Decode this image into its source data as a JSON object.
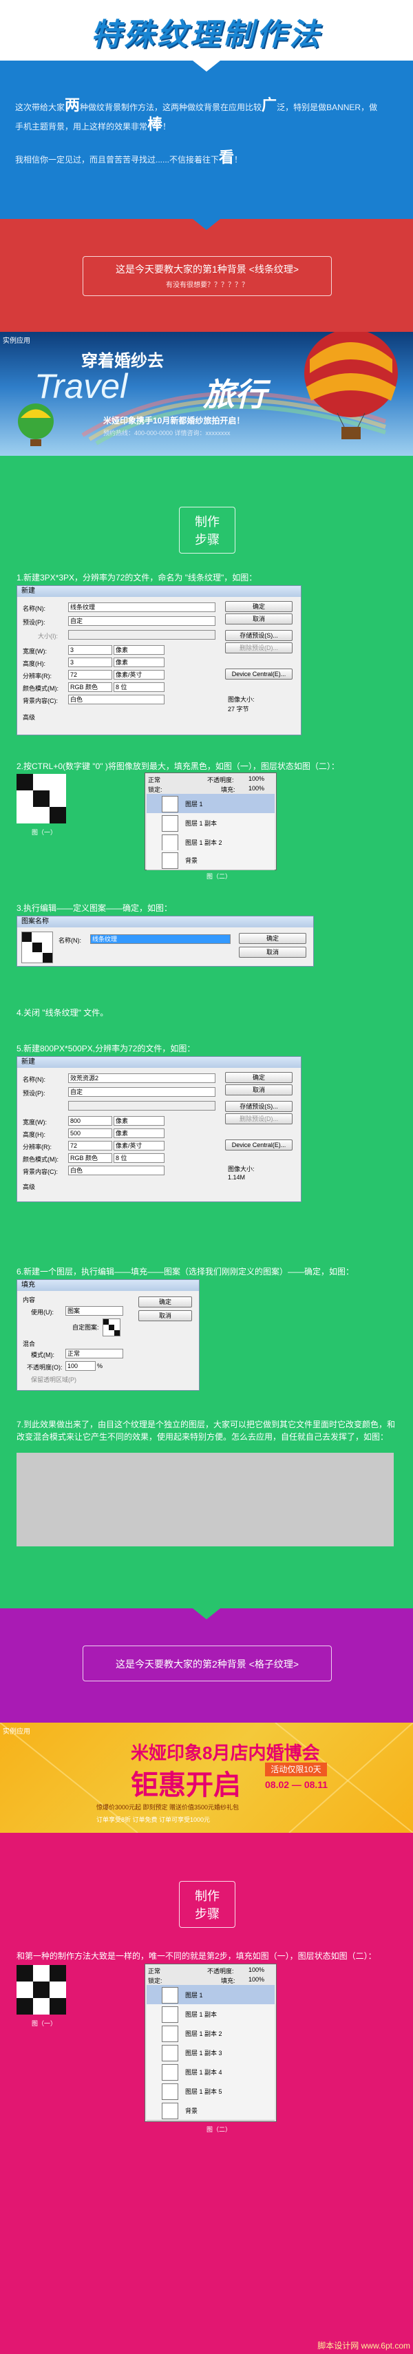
{
  "title": "特殊纹理制作法",
  "intro": {
    "line1_a": "这次带给大家",
    "line1_big": "两",
    "line1_b": "种做纹背景制作方法，这两种做纹背景在应用比较",
    "line1_big2": "广",
    "line1_c": "泛，特别是做BANNER，做",
    "line2_a": "手机主题背景，用上这样的效果非常",
    "line2_big": "棒",
    "line2_b": "！",
    "line3_a": "我相信你一定见过，而且曾苦苦寻找过......不信接着往下",
    "line3_big": "看",
    "line3_b": "！"
  },
  "section1": {
    "line1": "这是今天要教大家的第1种背景 <线条纹理>",
    "line2": "有没有很想要？？？？？？"
  },
  "banner1": {
    "tag": "实例应用",
    "c1": "穿着婚纱去",
    "c2": "Travel",
    "c3": "旅行",
    "c4": "米娅印象携手10月新都婚纱旅拍开启！",
    "c5": "预约热线：400-000-0000  详情咨询：xxxxxxxx"
  },
  "steps_title": [
    "制作",
    "步骤"
  ],
  "steps": {
    "s1": "1.新建3PX*3PX，分辨率为72的文件，命名为 \"线条纹理\"，如图：",
    "s2": "2.按CTRL+0(数字键 \"0\" )将图像放到最大，填充黑色，如图（一），图层状态如图（二）：",
    "s2_cap1": "图（一）",
    "s2_cap2": "图（二）",
    "s3": "3.执行编辑——定义图案——确定，如图：",
    "s4": "4.关闭 \"线条纹理\" 文件。",
    "s5": "5.新建800PX*500PX,分辨率为72的文件，如图：",
    "s6": "6.新建一个图层，执行编辑——填充——图案（选择我们刚刚定义的图案）——确定，如图：",
    "s7": "7.到此效果做出来了，由目这个纹理是个独立的图层，大家可以把它做到其它文件里面时它改变颜色，和改变混合模式来让它产生不同的效果，使用起来特别方便。怎么去应用，自任就自己去发挥了，如图："
  },
  "dialog1": {
    "title": "新建",
    "name_label": "名称(N):",
    "name_value": "线条纹理",
    "preset_label": "预设(P):",
    "preset_value": "自定",
    "size_label": "大小(I):",
    "width_label": "宽度(W):",
    "width_value": "3",
    "height_label": "高度(H):",
    "height_value": "3",
    "res_label": "分辨率(R):",
    "res_value": "72",
    "mode_label": "颜色模式(M):",
    "mode_value": "RGB 颜色",
    "bits_value": "8 位",
    "bg_label": "背景内容(C):",
    "bg_value": "白色",
    "unit_px": "像素",
    "unit_ppi": "像素/英寸",
    "advanced": "高级",
    "ok": "确定",
    "cancel": "取消",
    "save_preset": "存储预设(S)...",
    "delete_preset": "删除预设(D)...",
    "device": "Device Central(E)...",
    "image_size_label": "图像大小:",
    "image_size_value": "27 字节"
  },
  "layers_panel": {
    "mode": "正常",
    "opacity_label": "不透明度:",
    "opacity": "100%",
    "lock_label": "锁定:",
    "fill_label": "填充:",
    "fill": "100%",
    "layers": [
      "图层 1",
      "图层 1 副本",
      "图层 1 副本 2",
      "背景"
    ]
  },
  "dialog2": {
    "title": "图案名称",
    "name_label": "名称(N):",
    "name_value": "线条纹理",
    "ok": "确定",
    "cancel": "取消"
  },
  "dialog3": {
    "title": "新建",
    "name_label": "名称(N):",
    "name_value": "效荒资源2",
    "preset_label": "预设(P):",
    "preset_value": "自定",
    "width_label": "宽度(W):",
    "width_value": "800",
    "height_label": "高度(H):",
    "height_value": "500",
    "res_label": "分辨率(R):",
    "res_value": "72",
    "mode_label": "颜色模式(M):",
    "mode_value": "RGB 颜色",
    "bits_value": "8 位",
    "bg_label": "背景内容(C):",
    "bg_value": "白色",
    "unit_px": "像素",
    "unit_ppi": "像素/英寸",
    "advanced": "高级",
    "ok": "确定",
    "cancel": "取消",
    "save_preset": "存储预设(S)...",
    "delete_preset": "删除预设(D)...",
    "device": "Device Central(E)...",
    "image_size_label": "图像大小:",
    "image_size_value": "1.14M"
  },
  "dialog4": {
    "title": "填充",
    "content_label": "内容",
    "use_label": "使用(U):",
    "use_value": "图案",
    "custom_label": "自定图案:",
    "blend_label": "混合",
    "mode_label": "模式(M):",
    "mode_value": "正常",
    "opacity_label": "不透明度(O):",
    "opacity_value": "100",
    "pct": "%",
    "keep_label": "保留透明区域(P)",
    "ok": "确定",
    "cancel": "取消"
  },
  "section2": {
    "line1": "这是今天要教大家的第2种背景 <格子纹理>"
  },
  "banner2": {
    "tag": "实例应用",
    "b1": "米娅印象8月店内婚博会",
    "b2": "钜惠开启",
    "b3": "活动仅限10天",
    "b4": "08.02 — 08.11",
    "b5": "惊爆价3000元起  即刻预定  赠送价值3500元婚纱礼包",
    "b6": "订单享受8折  订单免费  订单可享受1000元"
  },
  "steps2_title": [
    "制作",
    "步骤"
  ],
  "steps2": {
    "s1": "和第一种的制作方法大致是一样的，唯一不同的就是第2步，填充如图（一），图层状态如图（二）：",
    "cap1": "图（一）",
    "cap2": "图（二）"
  },
  "layers_panel2": {
    "mode": "正常",
    "opacity_label": "不透明度:",
    "opacity": "100%",
    "lock_label": "锁定:",
    "fill_label": "填充:",
    "fill": "100%",
    "layers": [
      "图层 1",
      "图层 1 副本",
      "图层 1 副本 2",
      "图层 1 副本 3",
      "图层 1 副本 4",
      "图层 1 副本 5",
      "背景"
    ]
  },
  "watermark": "脚本设计网  www.6pt.com"
}
